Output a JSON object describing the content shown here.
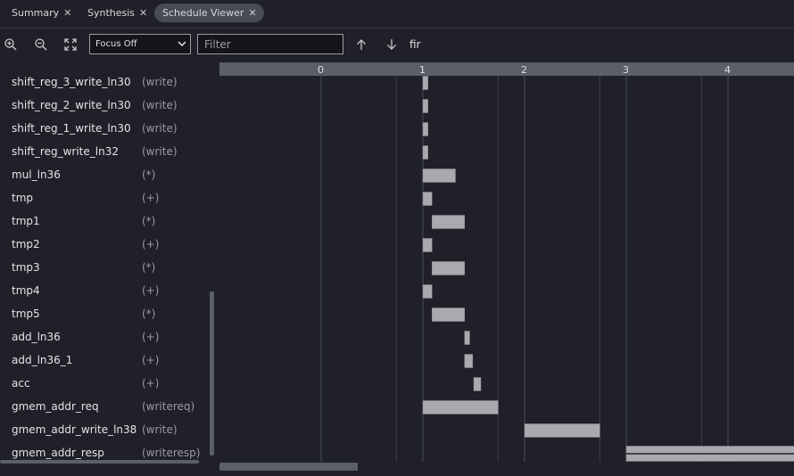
{
  "tabs": [
    {
      "label": "Summary",
      "active": false
    },
    {
      "label": "Synthesis",
      "active": false
    },
    {
      "label": "Schedule Viewer",
      "active": true
    }
  ],
  "toolbar": {
    "focus_select_value": "Focus Off",
    "filter_placeholder": "Filter",
    "function_name": "fir"
  },
  "colors": {
    "background": "#1f2028",
    "ruler": "#5c5e69",
    "bar": "#a9aab0",
    "active_tab": "#484a56"
  },
  "operations": [
    {
      "name": "shift_reg_3_write_ln30",
      "op": "(write)",
      "start": 1.0,
      "end": 1.05
    },
    {
      "name": "shift_reg_2_write_ln30",
      "op": "(write)",
      "start": 1.0,
      "end": 1.05
    },
    {
      "name": "shift_reg_1_write_ln30",
      "op": "(write)",
      "start": 1.0,
      "end": 1.05
    },
    {
      "name": "shift_reg_write_ln32",
      "op": "(write)",
      "start": 1.0,
      "end": 1.05
    },
    {
      "name": "mul_ln36",
      "op": "(*)",
      "start": 1.0,
      "end": 1.32
    },
    {
      "name": "tmp",
      "op": "(+)",
      "start": 1.0,
      "end": 1.09
    },
    {
      "name": "tmp1",
      "op": "(*)",
      "start": 1.09,
      "end": 1.41
    },
    {
      "name": "tmp2",
      "op": "(+)",
      "start": 1.0,
      "end": 1.09
    },
    {
      "name": "tmp3",
      "op": "(*)",
      "start": 1.09,
      "end": 1.41
    },
    {
      "name": "tmp4",
      "op": "(+)",
      "start": 1.0,
      "end": 1.09
    },
    {
      "name": "tmp5",
      "op": "(*)",
      "start": 1.09,
      "end": 1.41
    },
    {
      "name": "add_ln36",
      "op": "(+)",
      "start": 1.41,
      "end": 1.46
    },
    {
      "name": "add_ln36_1",
      "op": "(+)",
      "start": 1.41,
      "end": 1.49
    },
    {
      "name": "acc",
      "op": "(+)",
      "start": 1.5,
      "end": 1.57
    },
    {
      "name": "gmem_addr_req",
      "op": "(writereq)",
      "start": 1.0,
      "end": 1.74
    },
    {
      "name": "gmem_addr_write_ln38",
      "op": "(write)",
      "start": 2.0,
      "end": 2.74
    },
    {
      "name": "gmem_addr_resp",
      "op": "(writeresp)",
      "start": 3.0,
      "end": 4.66
    }
  ],
  "chart_data": {
    "type": "bar",
    "x_ticks": [
      "0",
      "1",
      "2",
      "3",
      "4"
    ],
    "grid": true
  }
}
